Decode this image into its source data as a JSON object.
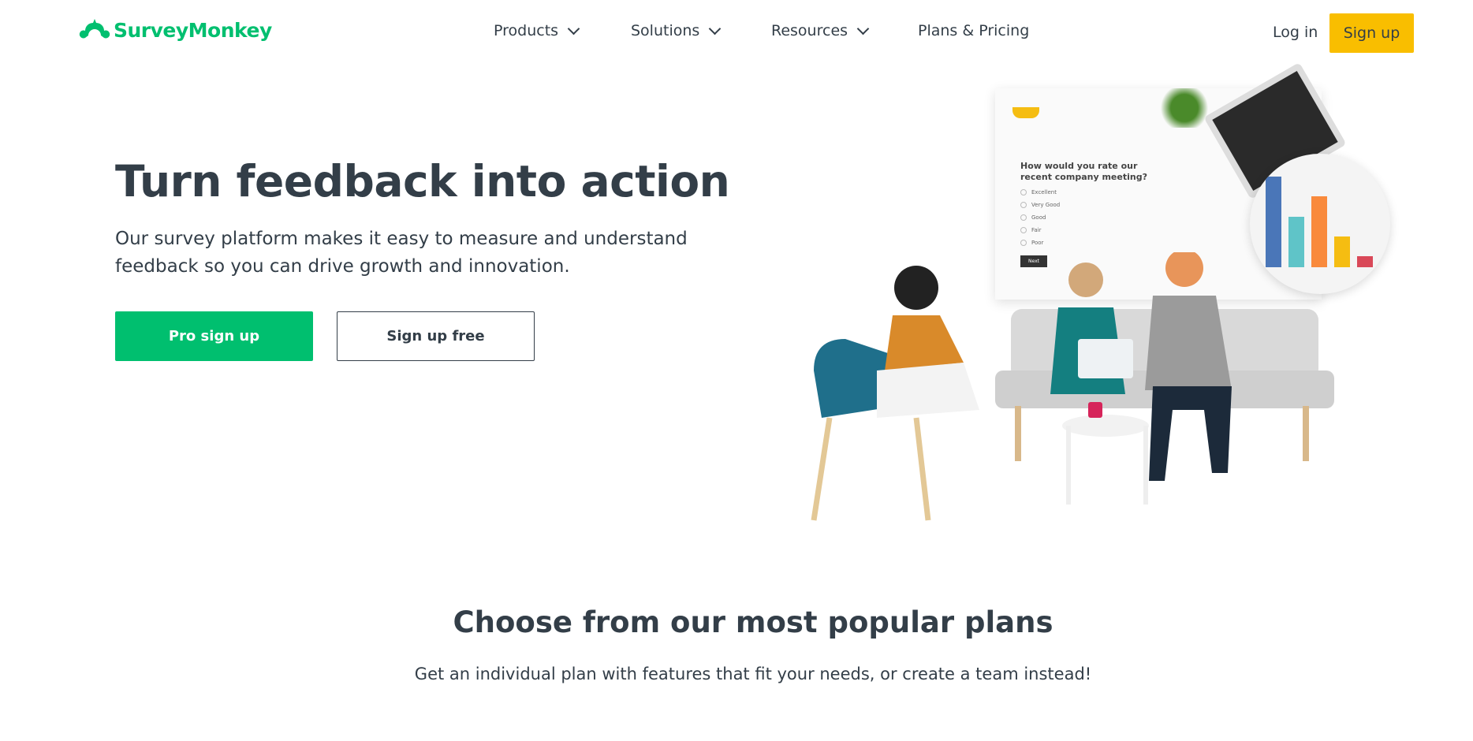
{
  "header": {
    "logo": "SurveyMonkey",
    "nav": [
      {
        "label": "Products"
      },
      {
        "label": "Solutions"
      },
      {
        "label": "Resources"
      },
      {
        "label": "Plans & Pricing"
      }
    ],
    "login": "Log in",
    "signup": "Sign up"
  },
  "hero": {
    "title": "Turn feedback into action",
    "subtitle_line1": "Our survey platform makes it easy to measure and understand",
    "subtitle_line2": "feedback so you can drive growth and innovation.",
    "pro_button": "Pro sign up",
    "free_button": "Sign up free",
    "illustration": {
      "question": "How would you rate our recent company meeting?",
      "options": [
        "Excellent",
        "Very Good",
        "Good",
        "Fair",
        "Poor"
      ],
      "next": "Next",
      "bars": [
        {
          "value": 100,
          "color": "#4a76b8"
        },
        {
          "value": 56,
          "color": "#5fc4c8"
        },
        {
          "value": 78,
          "color": "#f98a3c"
        },
        {
          "value": 34,
          "color": "#f5bd12"
        },
        {
          "value": 12,
          "color": "#d94858"
        }
      ]
    }
  },
  "plans": {
    "title": "Choose from our most popular plans",
    "subtitle": "Get an individual plan with features that fit your needs, or create a team instead!"
  },
  "colors": {
    "brand": "#00bf6f",
    "signup": "#f9be00",
    "text": "#333e48"
  }
}
